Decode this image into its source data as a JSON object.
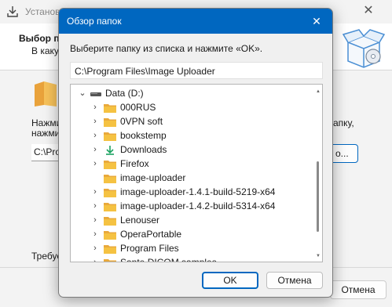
{
  "background_window": {
    "title": "Установ",
    "header_title": "Выбор па",
    "header_subtitle": "В каку",
    "text_line1": "Нажми",
    "text_line2": "нажмит",
    "text_right": "апку,",
    "path_value": "C:\\Prog",
    "browse_label": "о...",
    "required_text": "Требуе",
    "cancel_label": "Отмена",
    "window_control": "✕"
  },
  "dialog": {
    "title": "Обзор папок",
    "close_glyph": "✕",
    "instruction": "Выберите папку из списка и нажмите «OK».",
    "selected_path": "C:\\Program Files\\Image Uploader",
    "ok_label": "OK",
    "cancel_label": "Отмена"
  },
  "tree": {
    "root": {
      "label": "Data (D:)",
      "expanded": true,
      "icon": "drive-icon"
    },
    "items": [
      {
        "label": "000RUS",
        "has_children": true,
        "icon": "folder-icon"
      },
      {
        "label": "0VPN soft",
        "has_children": true,
        "icon": "folder-icon"
      },
      {
        "label": "bookstemp",
        "has_children": true,
        "icon": "folder-icon"
      },
      {
        "label": "Downloads",
        "has_children": true,
        "icon": "downloads-icon"
      },
      {
        "label": "Firefox",
        "has_children": true,
        "icon": "folder-icon"
      },
      {
        "label": "image-uploader",
        "has_children": false,
        "icon": "folder-icon"
      },
      {
        "label": "image-uploader-1.4.1-build-5219-x64",
        "has_children": true,
        "icon": "folder-icon"
      },
      {
        "label": "image-uploader-1.4.2-build-5314-x64",
        "has_children": true,
        "icon": "folder-icon"
      },
      {
        "label": "Lenouser",
        "has_children": true,
        "icon": "folder-icon"
      },
      {
        "label": "OperaPortable",
        "has_children": true,
        "icon": "folder-icon"
      },
      {
        "label": "Program Files",
        "has_children": true,
        "icon": "folder-icon"
      },
      {
        "label": "Sante DICOM samples",
        "has_children": true,
        "icon": "folder-icon"
      }
    ]
  },
  "colors": {
    "accent": "#0067c0",
    "folder_yellow": "#f5c242",
    "downloads_green": "#1aa260"
  }
}
